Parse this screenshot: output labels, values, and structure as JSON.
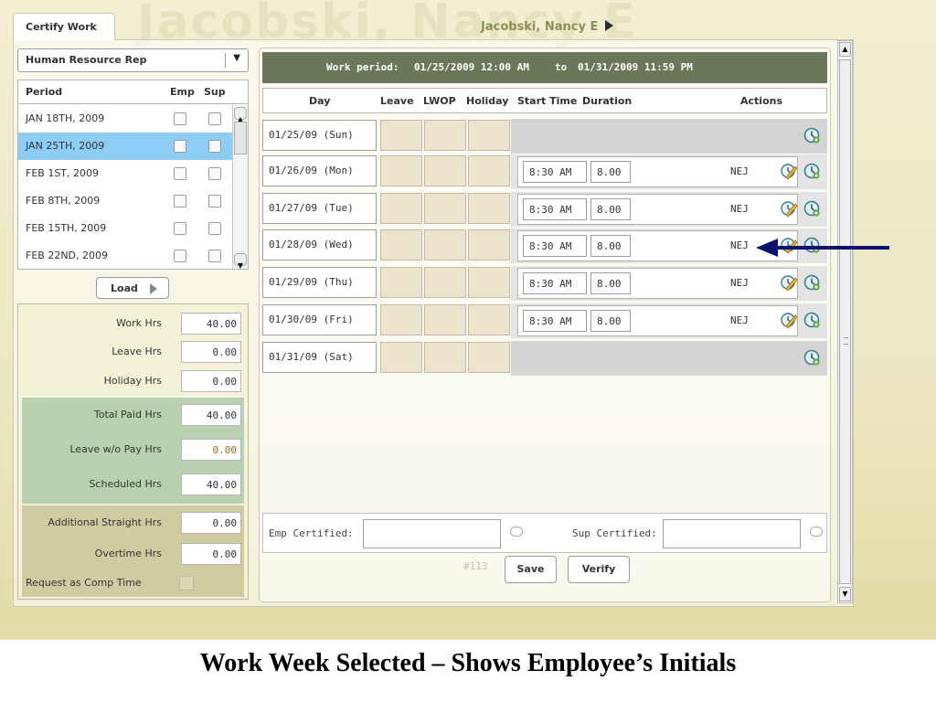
{
  "tab": {
    "label": "Certify Work"
  },
  "watermark": {
    "text": "Jacobski, Nancy E"
  },
  "employee": {
    "name": "Jacobski, Nancy E"
  },
  "role_select": {
    "value": "Human Resource Rep"
  },
  "periods": {
    "headers": {
      "period": "Period",
      "emp": "Emp",
      "sup": "Sup"
    },
    "rows": [
      {
        "label": "JAN 18TH, 2009",
        "selected": false
      },
      {
        "label": "JAN 25TH, 2009",
        "selected": true
      },
      {
        "label": "FEB 1ST, 2009",
        "selected": false
      },
      {
        "label": "FEB 8TH, 2009",
        "selected": false
      },
      {
        "label": "FEB 15TH, 2009",
        "selected": false
      },
      {
        "label": "FEB 22ND, 2009",
        "selected": false
      }
    ]
  },
  "load_button": {
    "label": "Load"
  },
  "totals": {
    "work_hrs": {
      "label": "Work Hrs",
      "value": "40.00"
    },
    "leave_hrs": {
      "label": "Leave Hrs",
      "value": "0.00"
    },
    "holiday_hrs": {
      "label": "Holiday Hrs",
      "value": "0.00"
    },
    "total_paid_hrs": {
      "label": "Total Paid Hrs",
      "value": "40.00"
    },
    "leave_wo_pay_hrs": {
      "label": "Leave w/o Pay Hrs",
      "value": "0.00"
    },
    "scheduled_hrs": {
      "label": "Scheduled Hrs",
      "value": "40.00"
    },
    "additional_straight_hrs": {
      "label": "Additional Straight Hrs",
      "value": "0.00"
    },
    "overtime_hrs": {
      "label": "Overtime Hrs",
      "value": "0.00"
    },
    "comp_time": {
      "label": "Request as Comp Time"
    }
  },
  "work_period": {
    "label": "Work period:",
    "start": "01/25/2009 12:00 AM",
    "to": "to",
    "end": "01/31/2009 11:59 PM"
  },
  "columns": {
    "day": "Day",
    "leave": "Leave",
    "lwop": "LWOP",
    "holiday": "Holiday",
    "start_time": "Start Time",
    "duration": "Duration",
    "actions": "Actions"
  },
  "days": [
    {
      "day": "01/25/09 (Sun)",
      "start": "",
      "duration": "",
      "initials": "",
      "worked": false
    },
    {
      "day": "01/26/09 (Mon)",
      "start": "8:30 AM",
      "duration": "8.00",
      "initials": "NEJ",
      "worked": true
    },
    {
      "day": "01/27/09 (Tue)",
      "start": "8:30 AM",
      "duration": "8.00",
      "initials": "NEJ",
      "worked": true
    },
    {
      "day": "01/28/09 (Wed)",
      "start": "8:30 AM",
      "duration": "8.00",
      "initials": "NEJ",
      "worked": true
    },
    {
      "day": "01/29/09 (Thu)",
      "start": "8:30 AM",
      "duration": "8.00",
      "initials": "NEJ",
      "worked": true
    },
    {
      "day": "01/30/09 (Fri)",
      "start": "8:30 AM",
      "duration": "8.00",
      "initials": "NEJ",
      "worked": true
    },
    {
      "day": "01/31/09 (Sat)",
      "start": "",
      "duration": "",
      "initials": "",
      "worked": false
    }
  ],
  "certify": {
    "emp_label": "Emp Certified:",
    "sup_label": "Sup Certified:"
  },
  "doc_number": "#113",
  "buttons": {
    "save": "Save",
    "verify": "Verify"
  },
  "caption": "Work Week Selected – Shows Employee’s Initials",
  "colors": {
    "header_bar": "#6a7758",
    "selected_row": "#8ecdf6",
    "arrow": "#10106e",
    "paid_band": "#b9d1b0",
    "extra_band": "#d0cca2"
  },
  "icons": {
    "edit": "edit-pencil-icon",
    "clock": "clock-add-icon"
  }
}
